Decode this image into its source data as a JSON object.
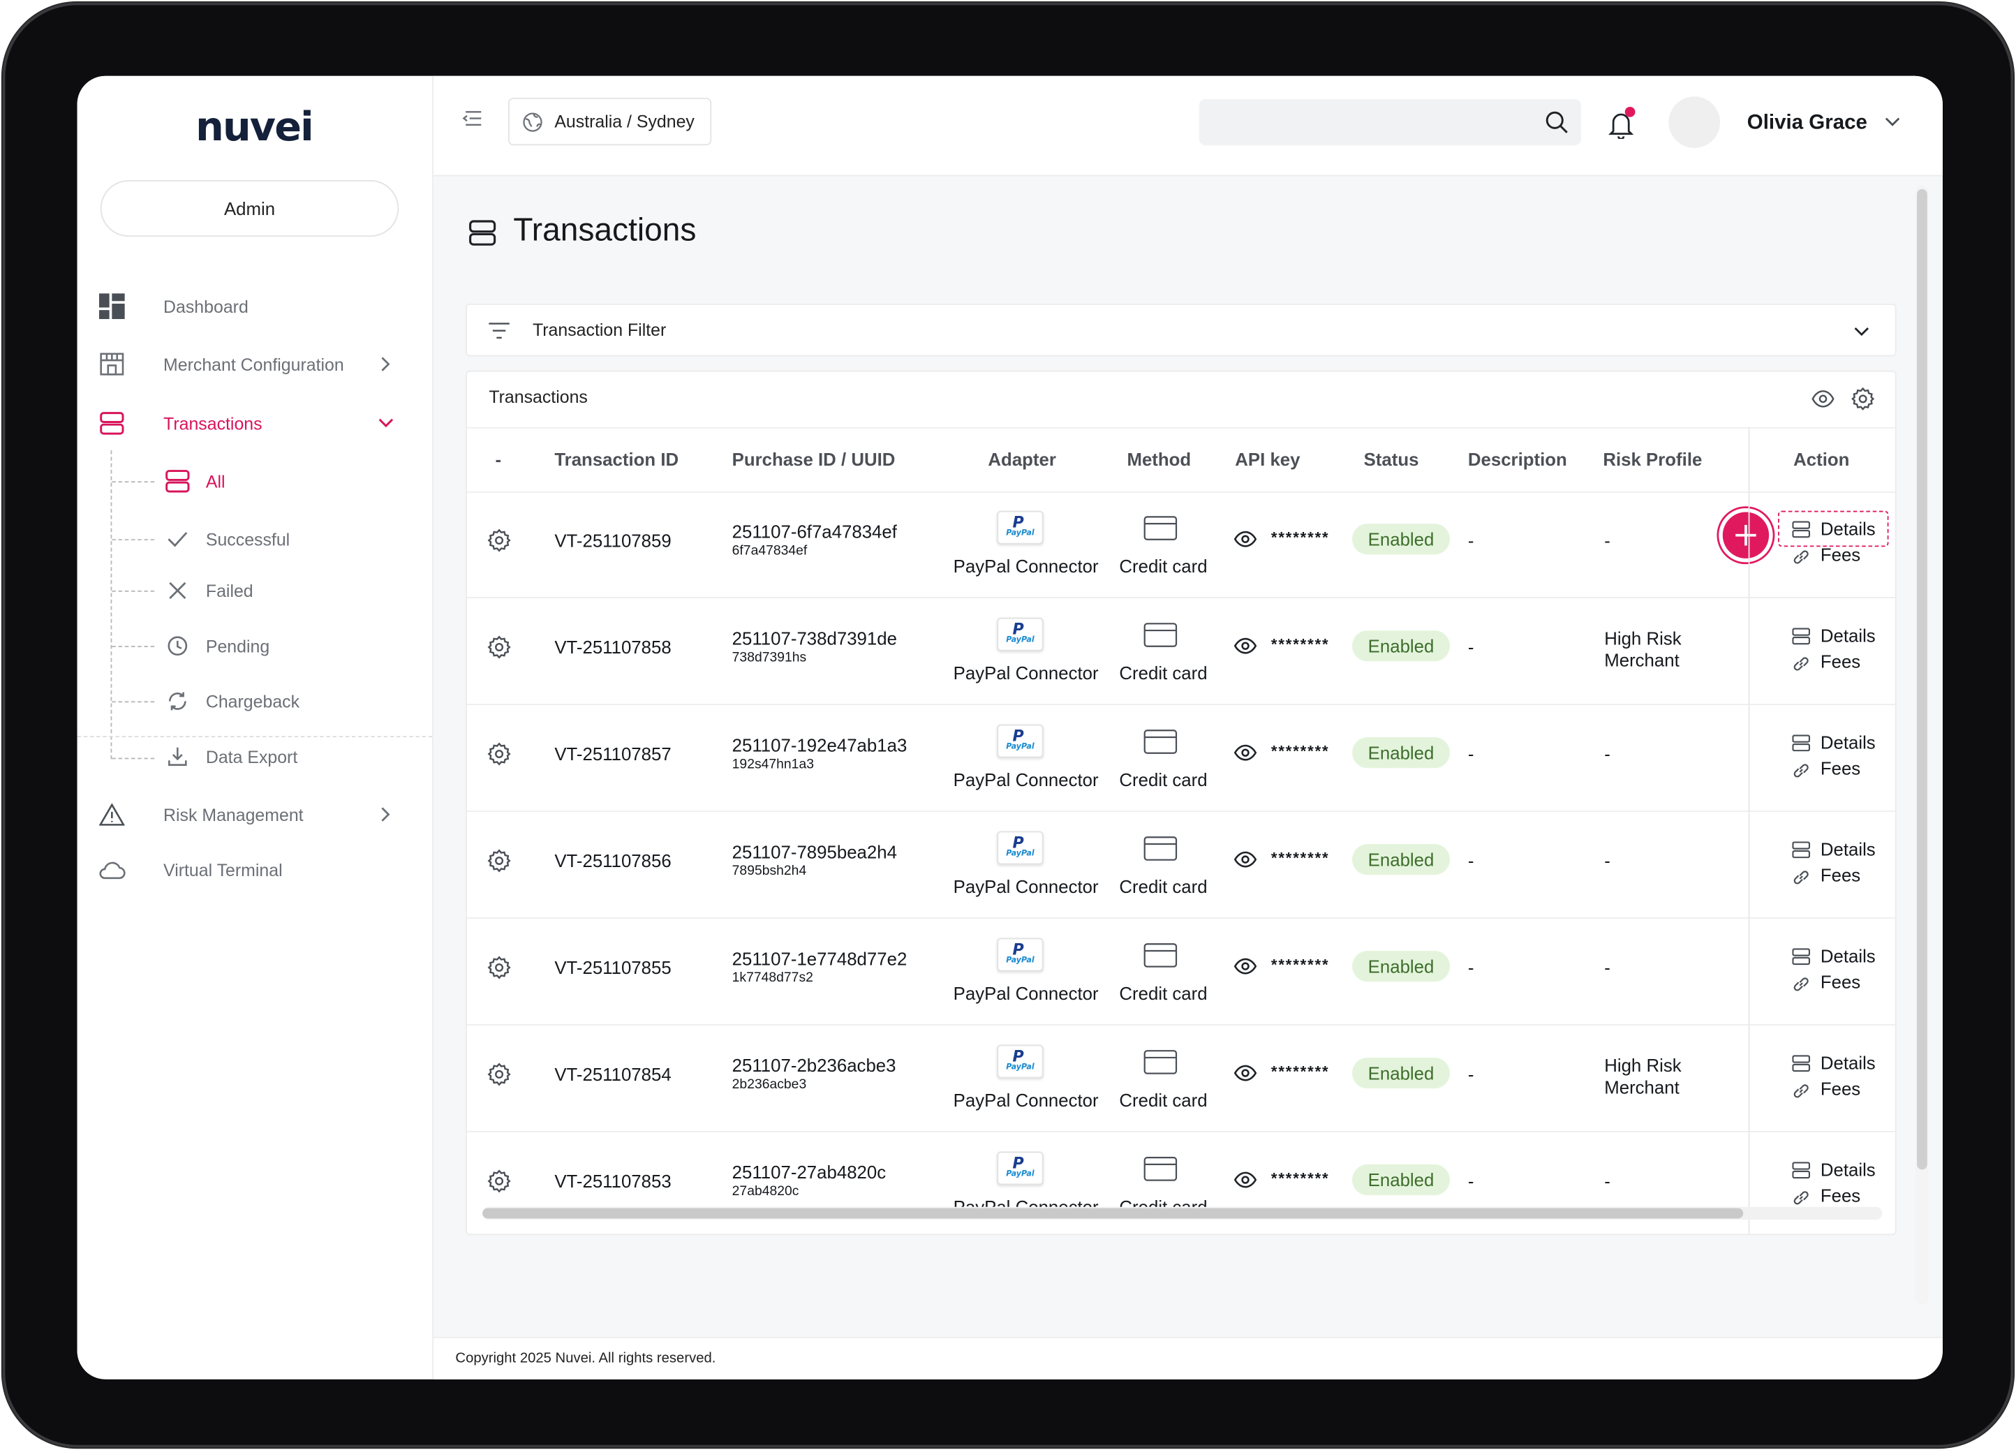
{
  "brand": {
    "logo_text": "nuvei",
    "accent_color": "#d8145b",
    "logo_color": "#15203a"
  },
  "sidebar": {
    "role": "Admin",
    "items": [
      {
        "label": "Dashboard",
        "icon": "dashboard-grid-icon",
        "has_chevron": false
      },
      {
        "label": "Merchant Configuration",
        "icon": "store-icon",
        "has_chevron": true
      },
      {
        "label": "Transactions",
        "icon": "stacked-list-icon",
        "has_chevron": true,
        "expanded": true,
        "active": true
      },
      {
        "label": "Risk Management",
        "icon": "warning-triangle-icon",
        "has_chevron": true
      },
      {
        "label": "Virtual Terminal",
        "icon": "cloud-icon",
        "has_chevron": false
      }
    ],
    "subitems": [
      {
        "label": "All",
        "icon": "stacked-list-icon",
        "active": true
      },
      {
        "label": "Successful",
        "icon": "check-icon"
      },
      {
        "label": "Failed",
        "icon": "x-icon"
      },
      {
        "label": "Pending",
        "icon": "clock-icon"
      },
      {
        "label": "Chargeback",
        "icon": "refresh-icon"
      },
      {
        "label": "Data Export",
        "icon": "download-icon"
      }
    ]
  },
  "topbar": {
    "timezone": "Australia / Sydney",
    "search_placeholder": "",
    "user_name": "Olivia Grace",
    "notification_unread": true
  },
  "page": {
    "title": "Transactions",
    "filter_label": "Transaction Filter",
    "table_title": "Transactions"
  },
  "table": {
    "columns": [
      "-",
      "Transaction ID",
      "Purchase ID / UUID",
      "Adapter",
      "Method",
      "API key",
      "Status",
      "Description",
      "Risk Profile",
      "Action"
    ],
    "rows": [
      {
        "id": "VT-251107859",
        "purchase_id": "251107-6f7a47834ef",
        "uuid": "6f7a47834ef",
        "adapter": "PayPal Connector",
        "method": "Credit card",
        "api_key": "********",
        "status": "Enabled",
        "description": "-",
        "risk": "-",
        "details": "Details",
        "fees": "Fees"
      },
      {
        "id": "VT-251107858",
        "purchase_id": "251107-738d7391de",
        "uuid": "738d7391hs",
        "adapter": "PayPal Connector",
        "method": "Credit card",
        "api_key": "********",
        "status": "Enabled",
        "description": "-",
        "risk": "High Risk Merchant",
        "details": "Details",
        "fees": "Fees"
      },
      {
        "id": "VT-251107857",
        "purchase_id": "251107-192e47ab1a3",
        "uuid": "192s47hn1a3",
        "adapter": "PayPal Connector",
        "method": "Credit card",
        "api_key": "********",
        "status": "Enabled",
        "description": "-",
        "risk": "-",
        "details": "Details",
        "fees": "Fees"
      },
      {
        "id": "VT-251107856",
        "purchase_id": "251107-7895bea2h4",
        "uuid": "7895bsh2h4",
        "adapter": "PayPal Connector",
        "method": "Credit card",
        "api_key": "********",
        "status": "Enabled",
        "description": "-",
        "risk": "-",
        "details": "Details",
        "fees": "Fees"
      },
      {
        "id": "VT-251107855",
        "purchase_id": "251107-1e7748d77e2",
        "uuid": "1k7748d77s2",
        "adapter": "PayPal Connector",
        "method": "Credit card",
        "api_key": "********",
        "status": "Enabled",
        "description": "-",
        "risk": "-",
        "details": "Details",
        "fees": "Fees"
      },
      {
        "id": "VT-251107854",
        "purchase_id": "251107-2b236acbe3",
        "uuid": "2b236acbe3",
        "adapter": "PayPal Connector",
        "method": "Credit card",
        "api_key": "********",
        "status": "Enabled",
        "description": "-",
        "risk": "High Risk Merchant",
        "details": "Details",
        "fees": "Fees"
      },
      {
        "id": "VT-251107853",
        "purchase_id": "251107-27ab4820c",
        "uuid": "27ab4820c",
        "adapter": "PayPal Connector",
        "method": "Credit card",
        "api_key": "********",
        "status": "Enabled",
        "description": "-",
        "risk": "-",
        "details": "Details",
        "fees": "Fees"
      }
    ]
  },
  "paypal_logo": {
    "mark": "P",
    "wordmark": "PayPal"
  },
  "footer": {
    "copyright": "Copyright 2025 Nuvei. All rights reserved."
  }
}
